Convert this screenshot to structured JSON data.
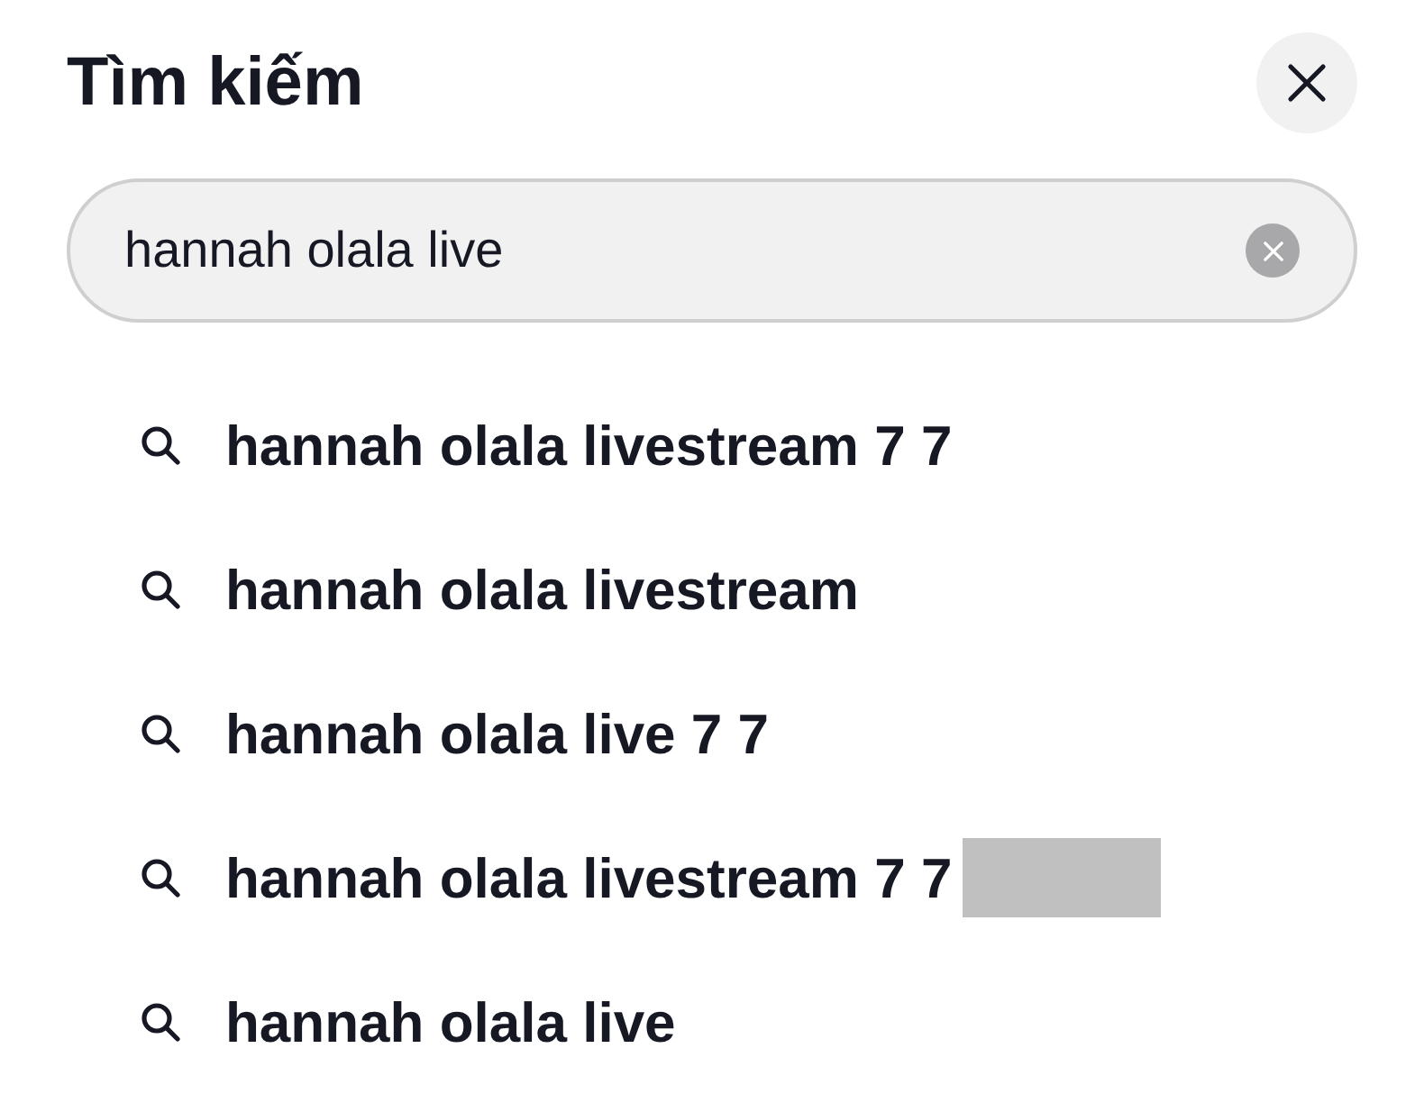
{
  "title": "Tìm kiếm",
  "search": {
    "value": "hannah olala live"
  },
  "suggestions": [
    {
      "text": "hannah olala livestream 7 7",
      "redacted": false
    },
    {
      "text": "hannah olala livestream",
      "redacted": false
    },
    {
      "text": "hannah olala live 7 7",
      "redacted": false
    },
    {
      "text": "hannah olala livestream 7 7",
      "redacted": true
    },
    {
      "text": "hannah olala live",
      "redacted": false
    }
  ]
}
